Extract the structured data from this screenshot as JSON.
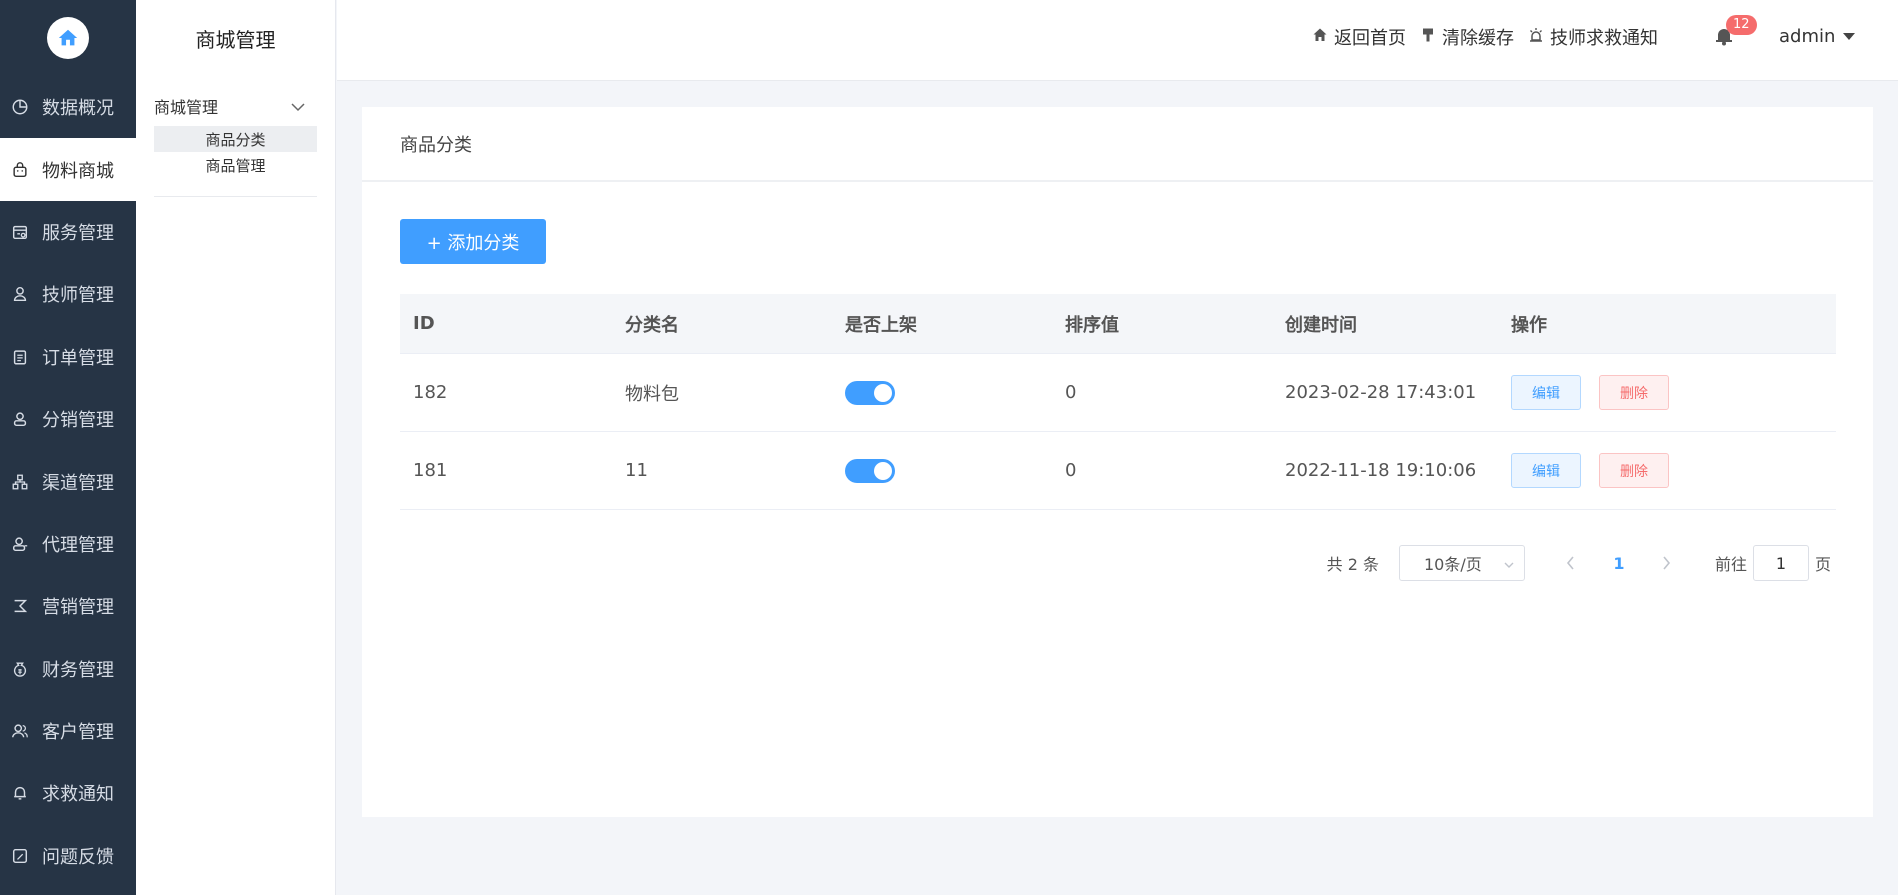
{
  "sidebar": {
    "items": [
      {
        "label": "数据概况",
        "icon": "pie-chart-icon"
      },
      {
        "label": "物料商城",
        "icon": "bag-icon"
      },
      {
        "label": "服务管理",
        "icon": "service-icon"
      },
      {
        "label": "技师管理",
        "icon": "person-icon"
      },
      {
        "label": "订单管理",
        "icon": "clipboard-icon"
      },
      {
        "label": "分销管理",
        "icon": "user-icon"
      },
      {
        "label": "渠道管理",
        "icon": "network-icon"
      },
      {
        "label": "代理管理",
        "icon": "agent-icon"
      },
      {
        "label": "营销管理",
        "icon": "marketing-icon"
      },
      {
        "label": "财务管理",
        "icon": "money-icon"
      },
      {
        "label": "客户管理",
        "icon": "customers-icon"
      },
      {
        "label": "求救通知",
        "icon": "bell-icon"
      },
      {
        "label": "问题反馈",
        "icon": "feedback-icon"
      }
    ]
  },
  "subside": {
    "title": "商城管理",
    "group_label": "商城管理",
    "items": [
      "商品分类",
      "商品管理"
    ]
  },
  "topbar": {
    "home_label": "返回首页",
    "clear_cache_label": "清除缓存",
    "rescue_label": "技师求救通知",
    "notification_count": "12",
    "user_name": "admin"
  },
  "main": {
    "title": "商品分类",
    "add_button": "+ 添加分类",
    "columns": [
      "ID",
      "分类名",
      "是否上架",
      "排序值",
      "创建时间",
      "操作"
    ],
    "rows": [
      {
        "id": "182",
        "name": "物料包",
        "on_shelf": true,
        "sort": "0",
        "created": "2023-02-28 17:43:01"
      },
      {
        "id": "181",
        "name": "11",
        "on_shelf": true,
        "sort": "0",
        "created": "2022-11-18 19:10:06"
      }
    ],
    "edit_label": "编辑",
    "delete_label": "删除"
  },
  "pagination": {
    "total": "共 2 条",
    "page_size": "10条/页",
    "current_page": "1",
    "goto_prefix": "前往",
    "goto_value": "1",
    "goto_suffix": "页"
  },
  "colors": {
    "accent": "#409eff",
    "danger": "#f56c6c",
    "sidebar_bg": "#263445"
  }
}
